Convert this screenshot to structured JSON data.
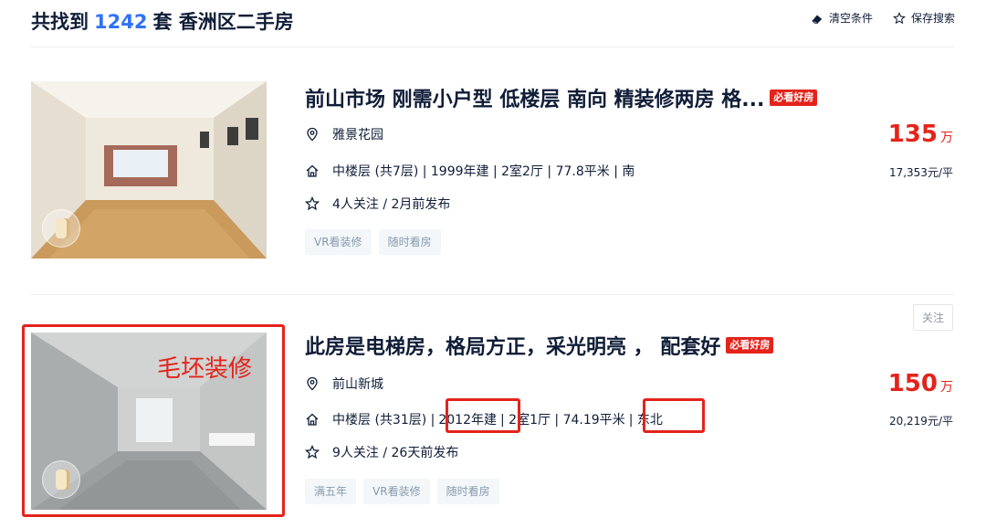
{
  "header": {
    "prefix": "共找到",
    "count": "1242",
    "suffix": "套 香洲区二手房",
    "clear_label": "清空条件",
    "save_label": "保存搜索"
  },
  "colors": {
    "accent": "#3072f6",
    "price": "#e4231b",
    "annotation": "#e4231b",
    "tag_bg": "#f4f7f9",
    "tag_text": "#849aae"
  },
  "listings": [
    {
      "title": "前山市场 刚需小户型 低楼层 南向 精装修两房 格...",
      "badge": "必看好房",
      "community": "雅景花园",
      "info": "中楼层 (共7层) | 1999年建 | 2室2厅 | 77.8平米 | 南",
      "follow": "4人关注 / 2月前发布",
      "tags": [
        "VR看装修",
        "随时看房"
      ],
      "price": "135",
      "price_unit": "万",
      "unit_price": "17,353元/平"
    },
    {
      "title": "此房是电梯房，格局方正，采光明亮 ， 配套好",
      "badge": "必看好房",
      "community": "前山新城",
      "info_parts": [
        "中楼层 (共31层) |",
        "2012年建",
        "| 2室1厅 | 74.19平米",
        "| 东北"
      ],
      "follow": "9人关注 / 26天前发布",
      "tags": [
        "满五年",
        "VR看装修",
        "随时看房"
      ],
      "price": "150",
      "price_unit": "万",
      "unit_price": "20,219元/平",
      "follow_button": "关注",
      "annotation": "毛坯装修"
    }
  ],
  "icons": [
    "eraser-icon",
    "star-outline-icon",
    "location-pin-icon",
    "house-icon",
    "star-icon",
    "vr-icon"
  ]
}
